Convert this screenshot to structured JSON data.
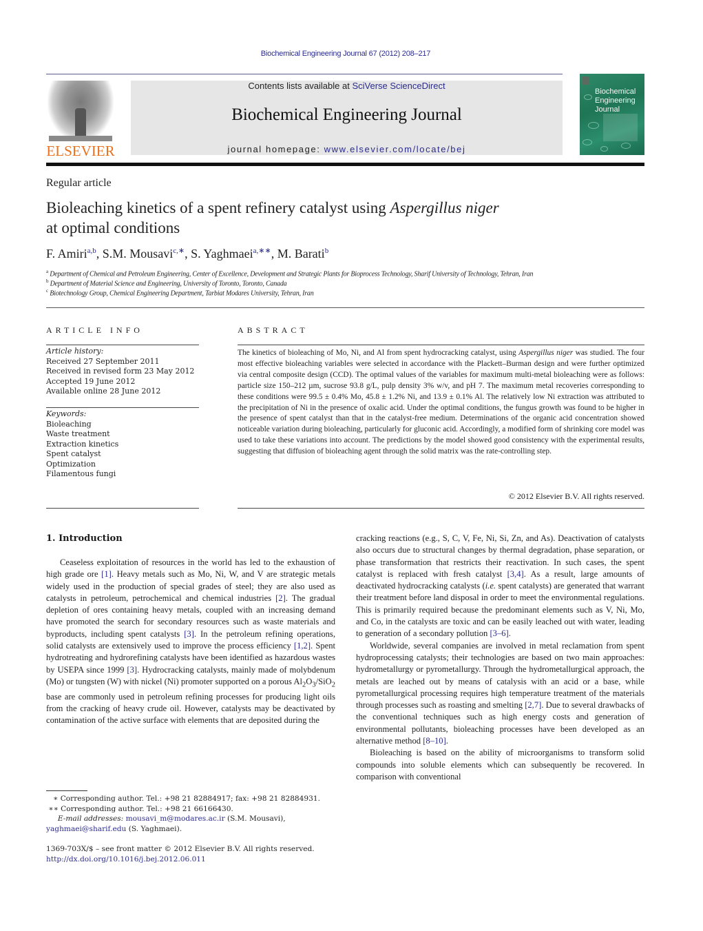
{
  "header": {
    "running_head": "Biochemical Engineering Journal 67 (2012) 208–217",
    "publisher_logo_text": "ELSEVIER",
    "contents_prefix": "Contents lists available at ",
    "contents_link": "SciVerse ScienceDirect",
    "journal_title": "Biochemical Engineering Journal",
    "homepage_prefix": "journal homepage: ",
    "homepage_link": "www.elsevier.com/locate/bej",
    "cover": {
      "line1": "Biochemical",
      "line2": "Engineering",
      "line3": "Journal"
    },
    "colors": {
      "link": "#2b2b8c",
      "elsevier_orange": "#e9711c",
      "header_box": "#e6e6e6",
      "cover_green": "#1f7556"
    }
  },
  "article": {
    "type": "Regular article",
    "title_part1": "Bioleaching kinetics of a spent refinery catalyst using ",
    "title_italic": "Aspergillus niger",
    "title_part2": "at optimal conditions",
    "authors": [
      {
        "name": "F. Amiri",
        "sup": "a,b"
      },
      {
        "name": "S.M. Mousavi",
        "sup": "c,∗"
      },
      {
        "name": "S. Yaghmaei",
        "sup": "a,∗∗"
      },
      {
        "name": "M. Barati",
        "sup": "b"
      }
    ],
    "affiliations": [
      {
        "key": "a",
        "text": "Department of Chemical and Petroleum Engineering, Center of Excellence, Development and Strategic Plants for Bioprocess Technology, Sharif University of Technology, Tehran, Iran"
      },
      {
        "key": "b",
        "text": "Department of Material Science and Engineering, University of Toronto, Toronto, Canada"
      },
      {
        "key": "c",
        "text": "Biotechnology Group, Chemical Engineering Department, Tarbiat Modares University, Tehran, Iran"
      }
    ]
  },
  "article_info": {
    "heading": "ARTICLE INFO",
    "history_label": "Article history:",
    "history": [
      "Received 27 September 2011",
      "Received in revised form 23 May 2012",
      "Accepted 19 June 2012",
      "Available online 28 June 2012"
    ],
    "keywords_label": "Keywords:",
    "keywords": [
      "Bioleaching",
      "Waste treatment",
      "Extraction kinetics",
      "Spent catalyst",
      "Optimization",
      "Filamentous fungi"
    ]
  },
  "abstract": {
    "heading": "ABSTRACT",
    "text_before_italic": "The kinetics of bioleaching of Mo, Ni, and Al from spent hydrocracking catalyst, using ",
    "italic": "Aspergillus niger",
    "text_after_italic": " was studied. The four most effective bioleaching variables were selected in accordance with the Plackett–Burman design and were further optimized via central composite design (CCD). The optimal values of the variables for maximum multi-metal bioleaching were as follows: particle size 150–212 µm, sucrose 93.8 g/L, pulp density 3% w/v, and pH 7. The maximum metal recoveries corresponding to these conditions were 99.5 ± 0.4% Mo, 45.8 ± 1.2% Ni, and 13.9 ± 0.1% Al. The relatively low Ni extraction was attributed to the precipitation of Ni in the presence of oxalic acid. Under the optimal conditions, the fungus growth was found to be higher in the presence of spent catalyst than that in the catalyst-free medium. Determinations of the organic acid concentration showed noticeable variation during bioleaching, particularly for gluconic acid. Accordingly, a modified form of shrinking core model was used to take these variations into account. The predictions by the model showed good consistency with the experimental results, suggesting that diffusion of bioleaching agent through the solid matrix was the rate-controlling step.",
    "copyright": "© 2012 Elsevier B.V. All rights reserved."
  },
  "introduction": {
    "heading": "1.  Introduction",
    "left_col": {
      "p1_a": "Ceaseless exploitation of resources in the world has led to the exhaustion of high grade ore ",
      "ref1": "[1]",
      "p1_b": ". Heavy metals such as Mo, Ni, W, and V are strategic metals widely used in the production of special grades of steel; they are also used as catalysts in petroleum, petrochemical and chemical industries ",
      "ref2": "[2]",
      "p1_c": ". The gradual depletion of ores containing heavy metals, coupled with an increasing demand have promoted the search for secondary resources such as waste materials and byproducts, including spent catalysts ",
      "ref3": "[3]",
      "p1_d": ". In the petroleum refining operations, solid catalysts are extensively used to improve the process efficiency ",
      "ref4": "[1,2]",
      "p1_e": ". Spent hydrotreating and hydrorefining catalysts have been identified as hazardous wastes by USEPA since 1999 ",
      "ref5": "[3]",
      "p1_f": ". Hydrocracking catalysts, mainly made of molybdenum (Mo) or tungsten (W) with nickel (Ni) promoter supported on a porous Al",
      "sub1": "2",
      "p1_g": "O",
      "sub2": "3",
      "p1_h": "/SiO",
      "sub3": "2",
      "p1_i": " base are commonly used in petroleum refining processes for producing light oils from the cracking of heavy crude oil. However, catalysts may be deactivated by contamination of the active surface with elements that are deposited during the"
    },
    "right_col": {
      "p1_a": "cracking reactions (e.g., S, C, V, Fe, Ni, Si, Zn, and As). Deactivation of catalysts also occurs due to structural changes by thermal degradation, phase separation, or phase transformation that restricts their reactivation. In such cases, the spent catalyst is replaced with fresh catalyst ",
      "ref1": "[3,4]",
      "p1_b": ". As a result, large amounts of deactivated hydrocracking catalysts (",
      "ie": "i.e.",
      "p1_c": " spent catalysts) are generated that warrant their treatment before land disposal in order to meet the environmental regulations. This is primarily required because the predominant elements such as V, Ni, Mo, and Co, in the catalysts are toxic and can be easily leached out with water, leading to generation of a secondary pollution ",
      "ref2": "[3–6]",
      "p1_d": ".",
      "p2_a": "Worldwide, several companies are involved in metal reclamation from spent hydroprocessing catalysts; their technologies are based on two main approaches: hydrometallurgy or pyrometallurgy. Through the hydrometallurgical approach, the metals are leached out by means of catalysis with an acid or a base, while pyrometallurgical processing requires high temperature treatment of the materials through processes such as roasting and smelting ",
      "ref3": "[2,7]",
      "p2_b": ". Due to several drawbacks of the conventional techniques such as high energy costs and generation of environmental pollutants, bioleaching processes have been developed as an alternative method ",
      "ref4": "[8–10]",
      "p2_c": ".",
      "p3": "Bioleaching is based on the ability of microorganisms to transform solid compounds into soluble elements which can subsequently be recovered. In comparison with conventional"
    }
  },
  "footnotes": {
    "fn1_mark": "∗",
    "fn1": "Corresponding author. Tel.: +98 21 82884917; fax: +98 21 82884931.",
    "fn2_mark": "∗∗",
    "fn2": "Corresponding author. Tel.: +98 21 66166430.",
    "email_label": "E-mail addresses:",
    "email1": "mousavi_m@modares.ac.ir",
    "email1_owner": " (S.M. Mousavi),",
    "email2": "yaghmaei@sharif.edu",
    "email2_owner": " (S. Yaghmaei).",
    "issn_line": "1369-703X/$ – see front matter © 2012 Elsevier B.V. All rights reserved.",
    "doi": "http://dx.doi.org/10.1016/j.bej.2012.06.011"
  }
}
